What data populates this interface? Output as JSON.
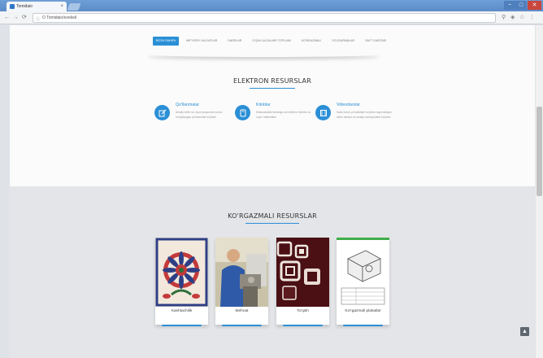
{
  "browser": {
    "tab_title": "Tomidaio",
    "tab_close": "×",
    "address": "O Tomidaio/ezekeil",
    "nav_back": "←",
    "nav_forward": "→",
    "nav_reload": "⟳",
    "win_min": "−",
    "win_max": "□",
    "win_close": "✕"
  },
  "site_nav": {
    "items": [
      {
        "label": "BOSH SAHIFA"
      },
      {
        "label": "ME'YORIY HUJJATLAR"
      },
      {
        "label": "DARSLAR"
      },
      {
        "label": "O'QUV-ULGULARI TO'PLAMI"
      },
      {
        "label": "KO'RGAZMALI"
      },
      {
        "label": "YO'LDURMALAR"
      },
      {
        "label": "SAYT XARITASI"
      }
    ]
  },
  "electron": {
    "title": "ELEKTRON RESURSLAR",
    "items": [
      {
        "title": "Qo'llanmalar",
        "desc": "Amaliy ta'lim va o'quv jarayonlari uchun mo'ljallangan qo'llanmalar to'plami",
        "icon": "edit-icon"
      },
      {
        "title": "Kitoblar",
        "desc": "Mutaxassislik fanlariga oid elektron kitoblar va o'quv materiallari",
        "icon": "book-icon"
      },
      {
        "title": "Videodarslar",
        "desc": "Kasb-hunar yo'nalishlari bo'yicha tayyorlangan video darslar va amaliy mashg'ulotlar to'plami",
        "icon": "film-icon"
      }
    ]
  },
  "exhibit": {
    "title": "KO'RGAZMALI RESURSLAR",
    "cards": [
      {
        "label": "Kashtachilik"
      },
      {
        "label": "Mehnat"
      },
      {
        "label": "To'qish"
      },
      {
        "label": "Ko'rgazmali plakatlar"
      }
    ]
  },
  "scroll_top": "▲",
  "colors": {
    "accent": "#2b8fd6",
    "titlebar": "#5c8cc7",
    "section_gray": "#e3e5e8"
  }
}
